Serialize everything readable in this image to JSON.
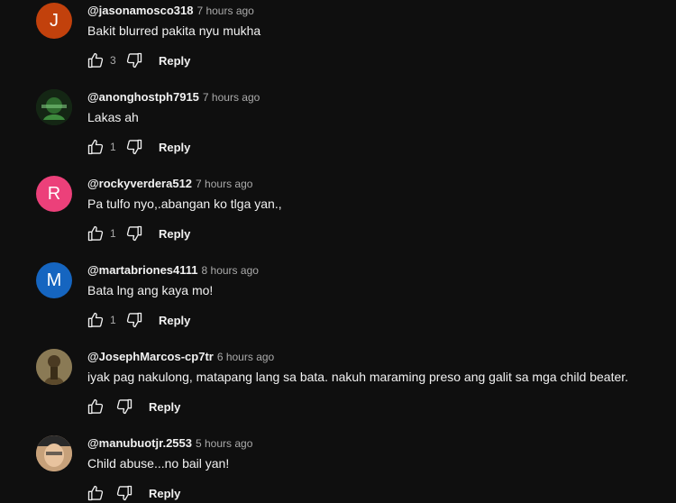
{
  "comments": [
    {
      "author": "@jasonamosco318",
      "time": "7 hours ago",
      "text": "Bakit blurred pakita nyu mukha",
      "likes": "3",
      "reply_label": "Reply",
      "avatar_letter": "J",
      "avatar_color": "#c2410c"
    },
    {
      "author": "@anonghostph7915",
      "time": "7 hours ago",
      "text": "Lakas ah",
      "likes": "1",
      "reply_label": "Reply",
      "avatar_letter": "",
      "avatar_color": "#1e3a1e"
    },
    {
      "author": "@rockyverdera512",
      "time": "7 hours ago",
      "text": "Pa tulfo nyo,.abangan ko tlga yan.,",
      "likes": "1",
      "reply_label": "Reply",
      "avatar_letter": "R",
      "avatar_color": "#ec407a"
    },
    {
      "author": "@martabriones4111",
      "time": "8 hours ago",
      "text": "Bata lng ang kaya mo!",
      "likes": "1",
      "reply_label": "Reply",
      "avatar_letter": "M",
      "avatar_color": "#1565c0"
    },
    {
      "author": "@JosephMarcos-cp7tr",
      "time": "6 hours ago",
      "text": "iyak pag nakulong, matapang lang sa bata. nakuh maraming preso ang galit sa mga child beater.",
      "likes": "",
      "reply_label": "Reply",
      "avatar_letter": "",
      "avatar_color": "#6b5a3a"
    },
    {
      "author": "@manubuotjr.2553",
      "time": "5 hours ago",
      "text": "Child abuse...no bail yan!",
      "likes": "",
      "reply_label": "Reply",
      "avatar_letter": "",
      "avatar_color": "#d9b48f"
    }
  ],
  "colors": {
    "background": "#0f0f0f",
    "text_primary": "#f1f1f1",
    "text_secondary": "#aaaaaa"
  },
  "icons": {
    "like": "thumbs-up-icon",
    "dislike": "thumbs-down-icon"
  }
}
